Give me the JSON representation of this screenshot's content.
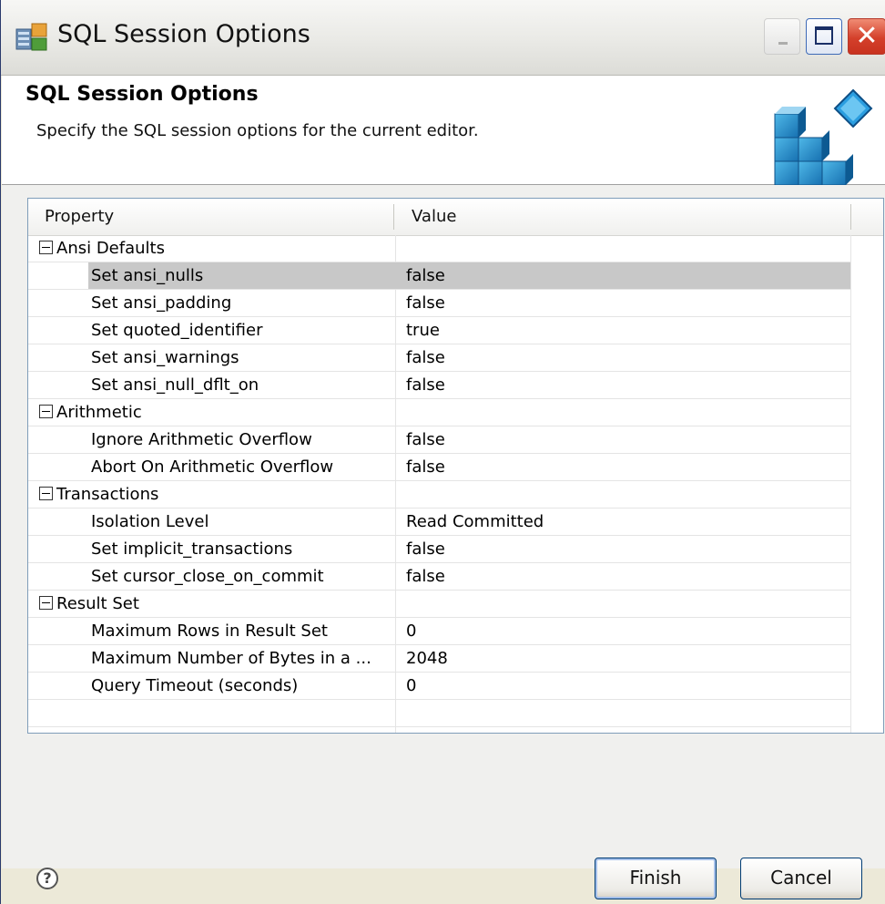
{
  "window": {
    "title": "SQL Session Options"
  },
  "header": {
    "title": "SQL Session Options",
    "description": "Specify the SQL session options for the current editor."
  },
  "table": {
    "columns": [
      "Property",
      "Value"
    ],
    "groups": [
      {
        "name": "Ansi Defaults",
        "rows": [
          {
            "property": "Set ansi_nulls",
            "value": "false",
            "selected": true
          },
          {
            "property": "Set ansi_padding",
            "value": "false"
          },
          {
            "property": "Set quoted_identifier",
            "value": "true"
          },
          {
            "property": "Set ansi_warnings",
            "value": "false"
          },
          {
            "property": "Set ansi_null_dflt_on",
            "value": "false"
          }
        ]
      },
      {
        "name": "Arithmetic",
        "rows": [
          {
            "property": "Ignore Arithmetic Overflow",
            "value": "false"
          },
          {
            "property": "Abort On Arithmetic Overflow",
            "value": "false"
          }
        ]
      },
      {
        "name": "Transactions",
        "rows": [
          {
            "property": "Isolation Level",
            "value": "Read Committed"
          },
          {
            "property": "Set implicit_transactions",
            "value": "false"
          },
          {
            "property": "Set cursor_close_on_commit",
            "value": "false"
          }
        ]
      },
      {
        "name": "Result Set",
        "rows": [
          {
            "property": "Maximum Rows in Result Set",
            "value": "0"
          },
          {
            "property": "Maximum Number of Bytes in a ...",
            "value": "2048"
          },
          {
            "property": "Query Timeout (seconds)",
            "value": "0"
          }
        ]
      }
    ]
  },
  "buttons": {
    "help": "?",
    "finish": "Finish",
    "cancel": "Cancel"
  },
  "icons": {
    "app": "database-settings-icon",
    "banner": "blocks-wizard-icon",
    "minimize": "minimize-icon",
    "maximize": "maximize-icon",
    "close": "close-icon",
    "help": "help-icon"
  },
  "colors": {
    "selection": "#c8c8c8",
    "close_button": "#d4402b",
    "banner_blue": "#1e88c8"
  }
}
